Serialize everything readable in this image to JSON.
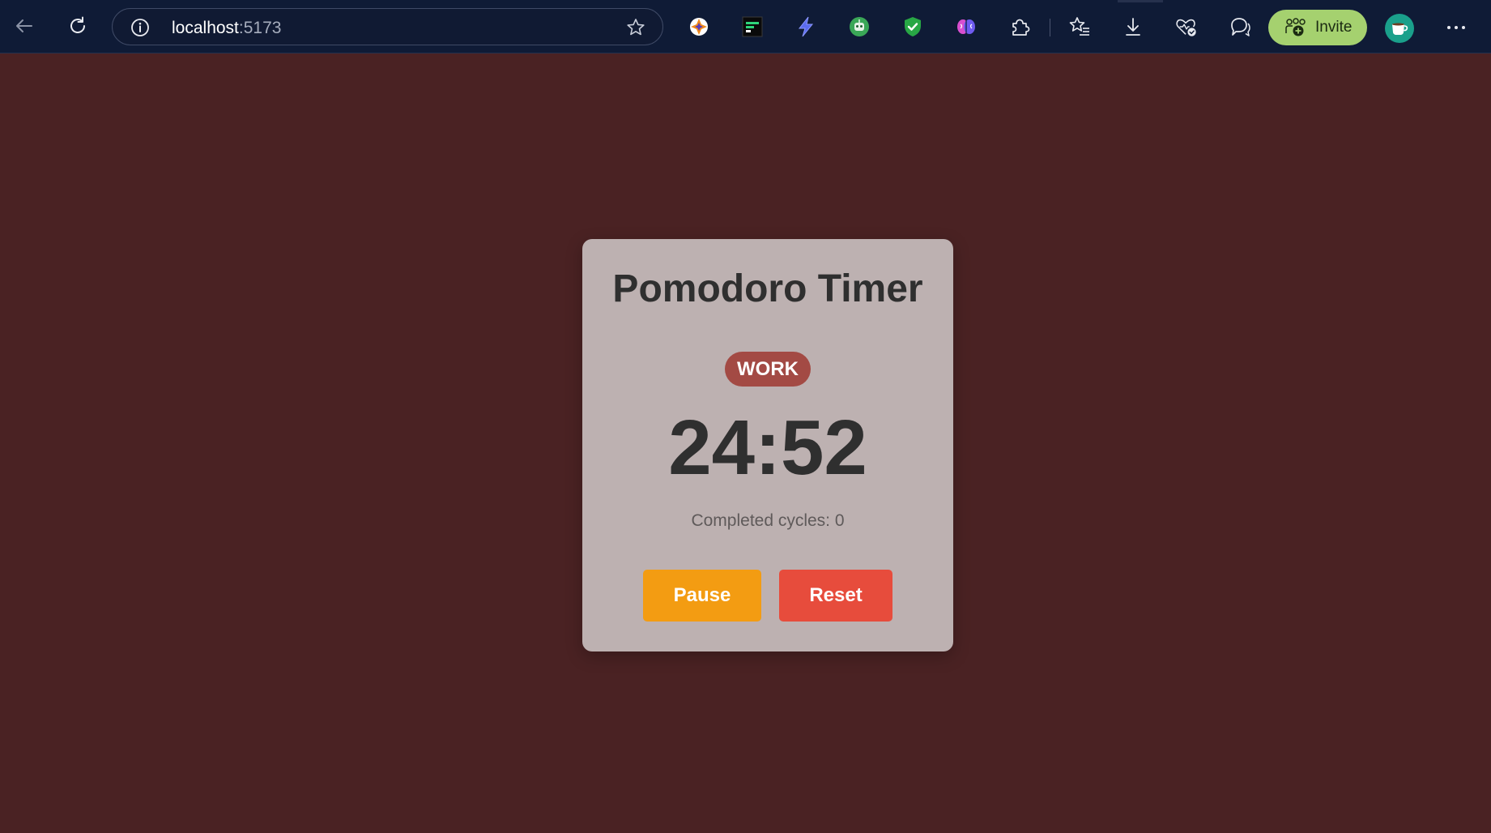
{
  "browser": {
    "url_host": "localhost",
    "url_port": ":5173",
    "invite_label": "Invite",
    "icons": {
      "back": "arrow-left-icon",
      "reload": "reload-icon",
      "info": "info-icon",
      "favorite": "star-icon",
      "extensions": [
        "sparkle-extension-icon",
        "terminal-extension-icon",
        "bolt-extension-icon",
        "robot-extension-icon",
        "shield-extension-icon",
        "brain-extension-icon",
        "puzzle-icon"
      ],
      "favorites_bar": "star-list-icon",
      "downloads": "download-icon",
      "health": "heart-check-icon",
      "chat": "chat-icon",
      "more": "more-dots-icon"
    },
    "colors": {
      "toolbar_bg": "#0f1b36",
      "invite_bg": "#a5d16f"
    }
  },
  "page": {
    "background": "#4a2223"
  },
  "timer": {
    "title": "Pomodoro Timer",
    "mode": "WORK",
    "time": "24:52",
    "cycles_text": "Completed cycles: 0",
    "pause_label": "Pause",
    "reset_label": "Reset",
    "colors": {
      "card_bg": "#bdb1b1",
      "mode_badge": "#a34a44",
      "pause_button": "#f39c12",
      "reset_button": "#e74c3c"
    }
  }
}
